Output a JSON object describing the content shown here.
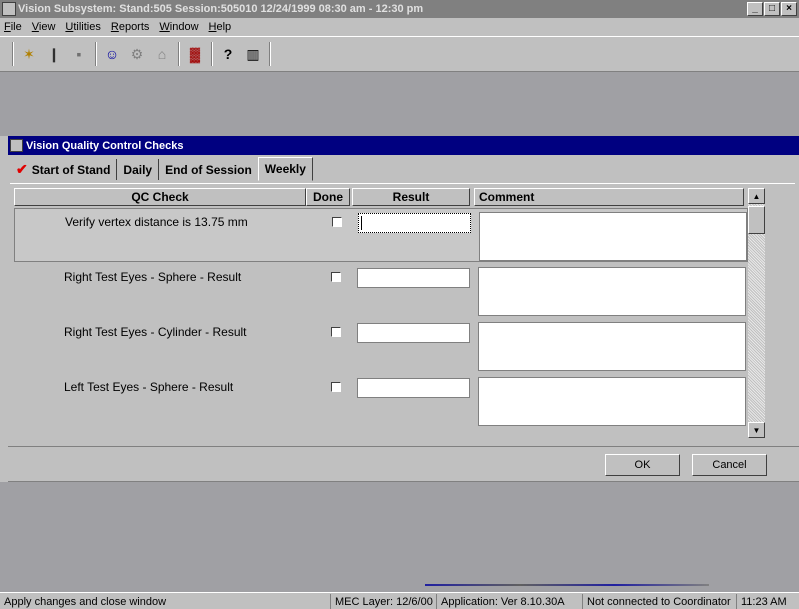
{
  "window": {
    "title": "Vision Subsystem: Stand:505 Session:505010 12/24/1999 08:30 am - 12:30 pm",
    "controls": [
      "_",
      "□",
      "×"
    ]
  },
  "menubar": [
    "File",
    "View",
    "Utilities",
    "Reports",
    "Window",
    "Help"
  ],
  "toolbar": [
    {
      "icon": "new-icon",
      "glyph": "✶"
    },
    {
      "icon": "clipboard-icon",
      "glyph": "❙"
    },
    {
      "icon": "paste-icon",
      "glyph": "▪"
    },
    {
      "icon": "people-icon",
      "glyph": "☺"
    },
    {
      "icon": "gear-icon",
      "glyph": "⚙"
    },
    {
      "icon": "cart-icon",
      "glyph": "⌂"
    },
    {
      "icon": "chart-icon",
      "glyph": "▓"
    },
    {
      "icon": "help-icon",
      "glyph": "?"
    },
    {
      "icon": "exit-icon",
      "glyph": "▥"
    }
  ],
  "dialog": {
    "title": "Vision Quality Control Checks",
    "tabs": [
      {
        "label": "Start of Stand",
        "checked": true
      },
      {
        "label": "Daily"
      },
      {
        "label": "End of Session"
      },
      {
        "label": "Weekly",
        "active": true
      }
    ],
    "columns": {
      "qc_check": "QC Check",
      "done": "Done",
      "result": "Result",
      "comment": "Comment"
    },
    "rows": [
      {
        "label": "Verify vertex distance is 13.75 mm",
        "done": false,
        "result": "",
        "comment": ""
      },
      {
        "label": "Right Test Eyes - Sphere - Result",
        "done": false,
        "result": "",
        "comment": ""
      },
      {
        "label": "Right Test Eyes - Cylinder - Result",
        "done": false,
        "result": "",
        "comment": ""
      },
      {
        "label": "Left Test Eyes - Sphere - Result",
        "done": false,
        "result": "",
        "comment": ""
      }
    ],
    "ok_label": "OK",
    "cancel_label": "Cancel"
  },
  "statusbar": {
    "message": "Apply changes and close window",
    "mec_layer": "MEC Layer: 12/6/00",
    "application": "Application: Ver 8.10.30A",
    "connection": "Not connected to Coordinator",
    "time": "11:23 AM"
  },
  "colors": {
    "title_active": "#000080",
    "title_inactive": "#808080",
    "check_mark": "#e00000",
    "face": "#c0c0c0"
  }
}
